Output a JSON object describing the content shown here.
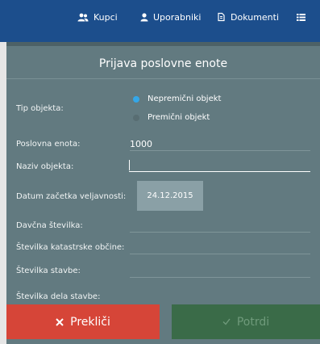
{
  "nav": {
    "items": [
      {
        "label": "Kupci",
        "icon": "users-icon"
      },
      {
        "label": "Uporabniki",
        "icon": "user-icon"
      },
      {
        "label": "Dokumenti",
        "icon": "document-icon"
      },
      {
        "label": "",
        "icon": "list-icon"
      }
    ]
  },
  "dialog": {
    "title": "Prijava poslovne enote",
    "fields": {
      "tip_objekta": {
        "label": "Tip objekta:",
        "options": [
          "Nepremični objekt",
          "Premični objekt"
        ],
        "selected": "Nepremični objekt"
      },
      "poslovna_enota": {
        "label": "Poslovna enota:",
        "value": "1000"
      },
      "naziv_objekta": {
        "label": "Naziv objekta:",
        "value": ""
      },
      "datum": {
        "label": "Datum začetka veljavnosti:",
        "value": "24.12.2015"
      },
      "davcna": {
        "label": "Davčna številka:",
        "value": ""
      },
      "katastrska": {
        "label": "Številka katastrske občine:",
        "value": ""
      },
      "stavba": {
        "label": "Številka stavbe:",
        "value": ""
      },
      "del_stavbe": {
        "label": "Številka dela stavbe:",
        "value": ""
      }
    },
    "buttons": {
      "cancel": "Prekliči",
      "confirm": "Potrdi"
    }
  },
  "colors": {
    "topbar": "#1c4e8c",
    "dialog_bg": "#627a80",
    "radio_accent": "#34a7e8",
    "cancel": "#d64538",
    "confirm": "#3a6b48"
  }
}
